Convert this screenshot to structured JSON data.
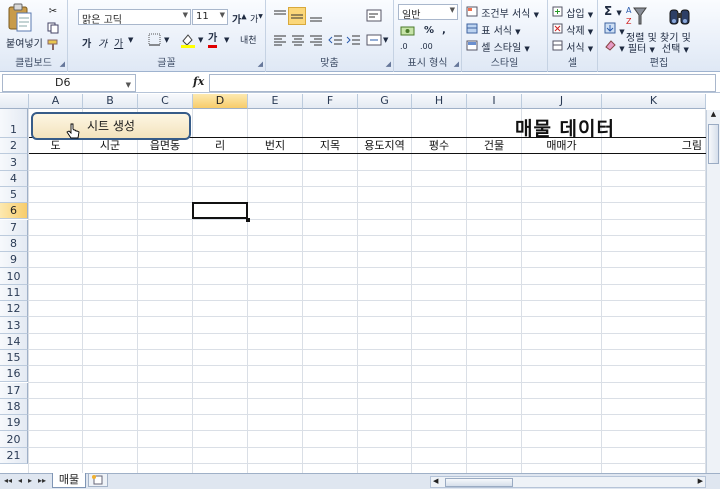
{
  "ribbon": {
    "clipboard": {
      "paste_label": "붙여넣기",
      "group_label": "클립보드"
    },
    "font": {
      "font_name": "맑은 고딕",
      "font_size": "11",
      "bold": "가",
      "italic": "가",
      "underline": "가",
      "grow": "가",
      "shrink": "가",
      "font_color_glyph": "가",
      "phonetic": "내천",
      "group_label": "글꼴"
    },
    "alignment": {
      "group_label": "맞춤"
    },
    "number": {
      "format": "일반",
      "percent": "%",
      "comma": ",",
      "inc_decimal": ".0",
      "dec_decimal": ".00",
      "group_label": "표시 형식"
    },
    "styles": {
      "conditional": "조건부 서식",
      "table": "표 서식",
      "cell": "셀 스타일",
      "group_label": "스타일"
    },
    "cells": {
      "insert": "삽입",
      "delete": "삭제",
      "format": "서식",
      "group_label": "셀"
    },
    "editing": {
      "sigma": "Σ",
      "sort_filter_1": "정렬 및",
      "sort_filter_2": "필터",
      "find_select_1": "찾기 및",
      "find_select_2": "선택",
      "group_label": "편집"
    }
  },
  "formula_bar": {
    "name_box": "D6",
    "fx": "fx",
    "formula": ""
  },
  "grid": {
    "columns": [
      "A",
      "B",
      "C",
      "D",
      "E",
      "F",
      "G",
      "H",
      "I",
      "J",
      "K"
    ],
    "selected_column": "D",
    "rows": [
      "1",
      "2",
      "3",
      "4",
      "5",
      "6",
      "7",
      "8",
      "9",
      "10",
      "11",
      "12",
      "13",
      "14",
      "15",
      "16",
      "17",
      "18",
      "19",
      "20",
      "21"
    ],
    "selected_row": "6",
    "header_cells": [
      "도",
      "시군",
      "읍면동",
      "리",
      "번지",
      "지목",
      "용도지역",
      "평수",
      "건물",
      "매매가",
      "그림"
    ],
    "sheet_button_label": "시트 생성",
    "title": "매물 데이터"
  },
  "sheets": {
    "tabs": [
      "매물"
    ],
    "nav": [
      "◂◂",
      "◂",
      "▸",
      "▸▸"
    ]
  },
  "colors": {
    "accent_header": "#f7cc6b",
    "button_border": "#375c89",
    "ribbon_bg": "#dfe8f5"
  }
}
